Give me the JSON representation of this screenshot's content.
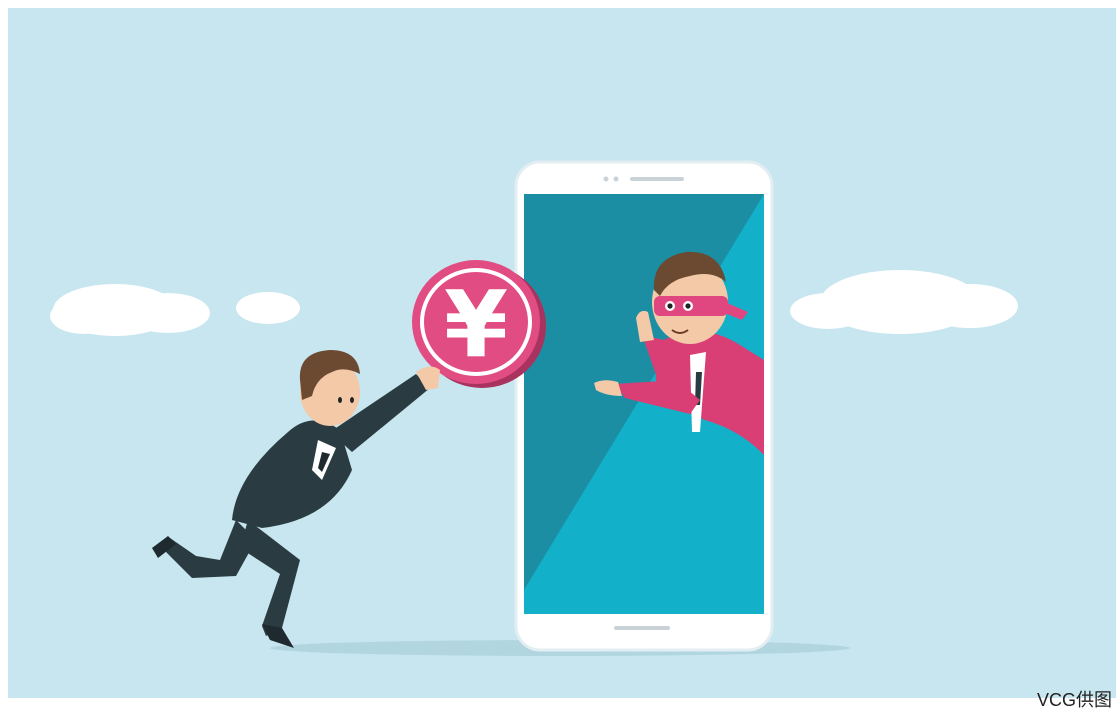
{
  "illustration": {
    "description_icon": "phone-scam-illustration",
    "currency_symbol": "¥",
    "credit": "VCG供图"
  },
  "colors": {
    "sky": "#c7e6ef",
    "cloud": "#ffffff",
    "phone_body": "#ffffff",
    "phone_screen_dark": "#1b8ea3",
    "phone_screen_light": "#12b1c9",
    "coin_pink": "#e14c83",
    "businessman_suit": "#2b3b42",
    "scammer_jacket": "#d93e75",
    "mask": "#e0467f",
    "hair": "#6b4a31",
    "skin": "#f3c9a8"
  }
}
